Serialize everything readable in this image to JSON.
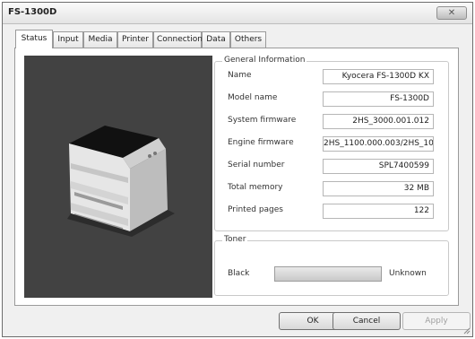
{
  "window": {
    "title": "FS-1300D",
    "close_label": "✕"
  },
  "tabs": [
    {
      "label": "Status",
      "active": true
    },
    {
      "label": "Input"
    },
    {
      "label": "Media"
    },
    {
      "label": "Printer"
    },
    {
      "label": "Connection"
    },
    {
      "label": "Data"
    },
    {
      "label": "Others"
    }
  ],
  "general": {
    "title": "General Information",
    "rows": [
      {
        "label": "Name",
        "value": "Kyocera FS-1300D KX"
      },
      {
        "label": "Model name",
        "value": "FS-1300D"
      },
      {
        "label": "System firmware",
        "value": "2HS_3000.001.012"
      },
      {
        "label": "Engine firmware",
        "value": "2HS_1100.000.003/2HS_10"
      },
      {
        "label": "Serial number",
        "value": "SPL7400599"
      },
      {
        "label": "Total memory",
        "value": "32 MB"
      },
      {
        "label": "Printed pages",
        "value": "122"
      }
    ]
  },
  "toner": {
    "title": "Toner",
    "label": "Black",
    "status": "Unknown"
  },
  "buttons": {
    "ok": "OK",
    "cancel": "Cancel",
    "apply": "Apply"
  }
}
